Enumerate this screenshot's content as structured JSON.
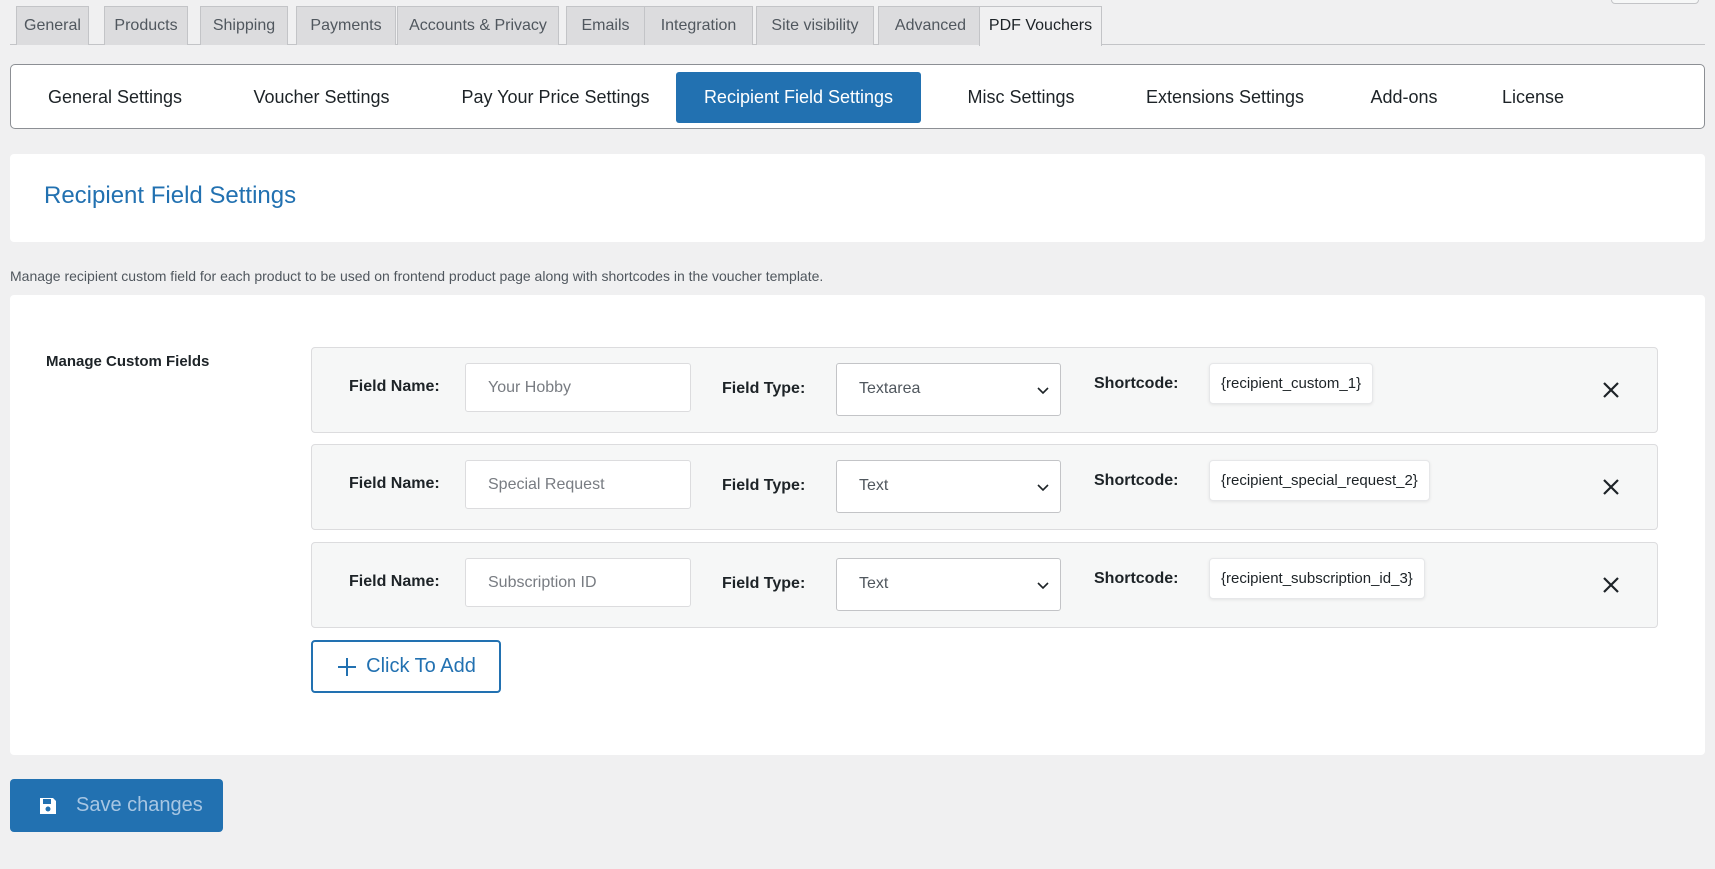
{
  "wc_tabs": [
    {
      "label": "General"
    },
    {
      "label": "Products"
    },
    {
      "label": "Shipping"
    },
    {
      "label": "Payments"
    },
    {
      "label": "Accounts & Privacy"
    },
    {
      "label": "Emails"
    },
    {
      "label": "Integration"
    },
    {
      "label": "Site visibility"
    },
    {
      "label": "Advanced"
    },
    {
      "label": "PDF Vouchers",
      "active": true
    }
  ],
  "sub_nav": [
    {
      "label": "General Settings"
    },
    {
      "label": "Voucher Settings"
    },
    {
      "label": "Pay Your Price Settings"
    },
    {
      "label": "Recipient Field Settings",
      "active": true
    },
    {
      "label": "Misc Settings"
    },
    {
      "label": "Extensions Settings"
    },
    {
      "label": "Add-ons"
    },
    {
      "label": "License"
    }
  ],
  "page": {
    "title": "Recipient Field Settings",
    "description": "Manage recipient custom field for each product to be used on frontend product page along with shortcodes in the voucher template."
  },
  "custom_fields": {
    "section_label": "Manage Custom Fields",
    "field_name_label": "Field Name:",
    "field_type_label": "Field Type:",
    "shortcode_label": "Shortcode:",
    "rows": [
      {
        "name_placeholder": "Your Hobby",
        "type": "Textarea",
        "shortcode": "{recipient_custom_1}"
      },
      {
        "name_placeholder": "Special Request",
        "type": "Text",
        "shortcode": "{recipient_special_request_2}"
      },
      {
        "name_placeholder": "Subscription ID",
        "type": "Text",
        "shortcode": "{recipient_subscription_id_3}"
      }
    ],
    "add_button_label": "Click To Add"
  },
  "save_button_label": "Save changes",
  "colors": {
    "accent": "#2271b1",
    "background": "#f0f0f1"
  }
}
